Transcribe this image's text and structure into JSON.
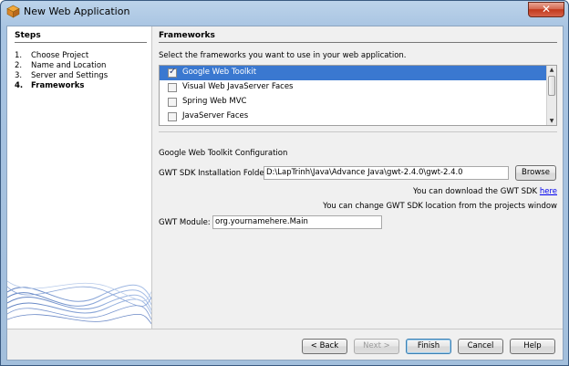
{
  "window": {
    "title": "New Web Application",
    "close_glyph": "✕"
  },
  "steps": {
    "title": "Steps",
    "items": [
      {
        "num": "1.",
        "label": "Choose Project",
        "current": false
      },
      {
        "num": "2.",
        "label": "Name and Location",
        "current": false
      },
      {
        "num": "3.",
        "label": "Server and Settings",
        "current": false
      },
      {
        "num": "4.",
        "label": "Frameworks",
        "current": true
      }
    ]
  },
  "panel": {
    "title": "Frameworks",
    "instructions": "Select the frameworks you want to use in your web application.",
    "frameworks": [
      {
        "label": "Google Web Toolkit",
        "checked": true,
        "selected": true
      },
      {
        "label": "Visual Web JavaServer Faces",
        "checked": false,
        "selected": false
      },
      {
        "label": "Spring Web MVC",
        "checked": false,
        "selected": false
      },
      {
        "label": "JavaServer Faces",
        "checked": false,
        "selected": false
      }
    ],
    "config_title": "Google Web Toolkit Configuration",
    "sdk_label": "GWT SDK Installation Folder:",
    "sdk_value": "D:\\LapTrinh\\Java\\Advance Java\\gwt-2.4.0\\gwt-2.4.0",
    "browse_label": "Browse",
    "download_note": "You can download the GWT SDK ",
    "download_link": "here",
    "location_note": "You can change GWT SDK location from the projects window",
    "module_label": "GWT Module:",
    "module_value": "org.yournamehere.Main"
  },
  "buttons": {
    "back": "< Back",
    "next": "Next >",
    "finish": "Finish",
    "cancel": "Cancel",
    "help": "Help"
  },
  "colors": {
    "selection": "#3a78d0",
    "link": "#0000ee",
    "close": "#c2381c"
  },
  "icons": {
    "app": "netbeans-cube-icon",
    "check": "checkmark-icon"
  }
}
